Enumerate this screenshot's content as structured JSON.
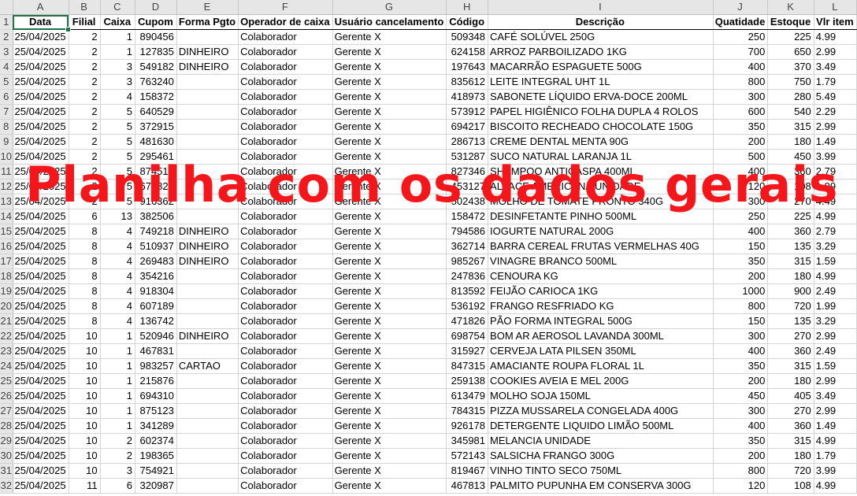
{
  "overlay_text": "Planilha com os dados gerais",
  "column_letters": [
    "A",
    "B",
    "C",
    "D",
    "E",
    "F",
    "G",
    "H",
    "I",
    "J",
    "K",
    "L"
  ],
  "headers": [
    "Data",
    "Filial",
    "Caixa",
    "Cupom",
    "Forma Pgto",
    "Operador de caixa",
    "Usuário cancelamento",
    "Código",
    "Descrição",
    "Quatidade",
    "Estoque",
    "Vlr item"
  ],
  "header_row_number": "1",
  "rows": [
    {
      "n": "2",
      "c": [
        "25/04/2025",
        "2",
        "1",
        "890456",
        "",
        "Colaborador",
        "Gerente X",
        "509348",
        "CAFÉ SOLÚVEL 250G",
        "250",
        "225",
        "4.99"
      ]
    },
    {
      "n": "3",
      "c": [
        "25/04/2025",
        "2",
        "1",
        "127835",
        "DINHEIRO",
        "Colaborador",
        "Gerente X",
        "624158",
        "ARROZ PARBOILIZADO 1KG",
        "700",
        "650",
        "2.99"
      ]
    },
    {
      "n": "4",
      "c": [
        "25/04/2025",
        "2",
        "3",
        "549182",
        "DINHEIRO",
        "Colaborador",
        "Gerente X",
        "197643",
        "MACARRÃO ESPAGUETE 500G",
        "400",
        "370",
        "3.49"
      ]
    },
    {
      "n": "5",
      "c": [
        "25/04/2025",
        "2",
        "3",
        "763240",
        "",
        "Colaborador",
        "Gerente X",
        "835612",
        "LEITE INTEGRAL UHT 1L",
        "800",
        "750",
        "1.79"
      ]
    },
    {
      "n": "6",
      "c": [
        "25/04/2025",
        "2",
        "4",
        "158372",
        "",
        "Colaborador",
        "Gerente X",
        "418973",
        "SABONETE LÍQUIDO ERVA-DOCE 200ML",
        "300",
        "280",
        "5.49"
      ]
    },
    {
      "n": "7",
      "c": [
        "25/04/2025",
        "2",
        "5",
        "640529",
        "",
        "Colaborador",
        "Gerente X",
        "573912",
        "PAPEL HIGIÊNICO FOLHA DUPLA 4 ROLOS",
        "600",
        "540",
        "2.29"
      ]
    },
    {
      "n": "8",
      "c": [
        "25/04/2025",
        "2",
        "5",
        "372915",
        "",
        "Colaborador",
        "Gerente X",
        "694217",
        "BISCOITO RECHEADO CHOCOLATE 150G",
        "350",
        "315",
        "2.99"
      ]
    },
    {
      "n": "9",
      "c": [
        "25/04/2025",
        "2",
        "5",
        "481630",
        "",
        "Colaborador",
        "Gerente X",
        "286713",
        "CREME DENTAL MENTA 90G",
        "200",
        "180",
        "1.49"
      ]
    },
    {
      "n": "10",
      "c": [
        "25/04/2025",
        "2",
        "5",
        "295461",
        "",
        "Colaborador",
        "Gerente X",
        "531287",
        "SUCO NATURAL LARANJA 1L",
        "500",
        "450",
        "3.99"
      ]
    },
    {
      "n": "11",
      "c": [
        "25/04/2025",
        "2",
        "5",
        "874510",
        "",
        "Colaborador",
        "Gerente X",
        "827346",
        "SHAMPOO ANTICASPA 400ML",
        "400",
        "360",
        "2.79"
      ]
    },
    {
      "n": "12",
      "c": [
        "25/04/2025",
        "2",
        "5",
        "673829",
        "",
        "Colaborador",
        "Gerente X",
        "453127",
        "ALFACE AMERICANA UNIDADE",
        "120",
        "108",
        "1.99"
      ]
    },
    {
      "n": "13",
      "c": [
        "25/04/2025",
        "2",
        "5",
        "916362",
        "",
        "Colaborador",
        "Gerente X",
        "502438",
        "MOLHO DE TOMATE PRONTO 340G",
        "300",
        "270",
        "4.49"
      ]
    },
    {
      "n": "14",
      "c": [
        "25/04/2025",
        "6",
        "13",
        "382506",
        "",
        "Colaborador",
        "Gerente X",
        "158472",
        "DESINFETANTE PINHO 500ML",
        "250",
        "225",
        "4.99"
      ]
    },
    {
      "n": "15",
      "c": [
        "25/04/2025",
        "8",
        "4",
        "749218",
        "DINHEIRO",
        "Colaborador",
        "Gerente X",
        "794586",
        "IOGURTE NATURAL 200G",
        "400",
        "360",
        "2.79"
      ]
    },
    {
      "n": "16",
      "c": [
        "25/04/2025",
        "8",
        "4",
        "510937",
        "DINHEIRO",
        "Colaborador",
        "Gerente X",
        "362714",
        "BARRA CEREAL FRUTAS VERMELHAS 40G",
        "150",
        "135",
        "3.29"
      ]
    },
    {
      "n": "17",
      "c": [
        "25/04/2025",
        "8",
        "4",
        "269483",
        "DINHEIRO",
        "Colaborador",
        "Gerente X",
        "985267",
        "VINAGRE BRANCO 500ML",
        "350",
        "315",
        "1.59"
      ]
    },
    {
      "n": "18",
      "c": [
        "25/04/2025",
        "8",
        "4",
        "354216",
        "",
        "Colaborador",
        "Gerente X",
        "247836",
        "CENOURA KG",
        "200",
        "180",
        "4.99"
      ]
    },
    {
      "n": "19",
      "c": [
        "25/04/2025",
        "8",
        "4",
        "918304",
        "",
        "Colaborador",
        "Gerente X",
        "813592",
        "FEIJÃO CARIOCA 1KG",
        "1000",
        "900",
        "2.49"
      ]
    },
    {
      "n": "20",
      "c": [
        "25/04/2025",
        "8",
        "4",
        "607189",
        "",
        "Colaborador",
        "Gerente X",
        "536192",
        "FRANGO RESFRIADO KG",
        "800",
        "720",
        "1.99"
      ]
    },
    {
      "n": "21",
      "c": [
        "25/04/2025",
        "8",
        "4",
        "136742",
        "",
        "Colaborador",
        "Gerente X",
        "471826",
        "PÃO FORMA INTEGRAL 500G",
        "150",
        "135",
        "3.29"
      ]
    },
    {
      "n": "22",
      "c": [
        "25/04/2025",
        "10",
        "1",
        "520946",
        "DINHEIRO",
        "Colaborador",
        "Gerente X",
        "698754",
        "BOM AR AEROSOL LAVANDA 300ML",
        "300",
        "270",
        "2.99"
      ]
    },
    {
      "n": "23",
      "c": [
        "25/04/2025",
        "10",
        "1",
        "467831",
        "",
        "Colaborador",
        "Gerente X",
        "315927",
        "CERVEJA LATA PILSEN 350ML",
        "400",
        "360",
        "2.49"
      ]
    },
    {
      "n": "24",
      "c": [
        "25/04/2025",
        "10",
        "1",
        "983257",
        "CARTAO",
        "Colaborador",
        "Gerente X",
        "847315",
        "AMACIANTE ROUPA FLORAL 1L",
        "350",
        "315",
        "1.59"
      ]
    },
    {
      "n": "25",
      "c": [
        "25/04/2025",
        "10",
        "1",
        "215876",
        "",
        "Colaborador",
        "Gerente X",
        "259138",
        "COOKIES AVEIA E MEL 200G",
        "200",
        "180",
        "2.99"
      ]
    },
    {
      "n": "26",
      "c": [
        "25/04/2025",
        "10",
        "1",
        "694310",
        "",
        "Colaborador",
        "Gerente X",
        "613479",
        "MOLHO SOJA 150ML",
        "450",
        "405",
        "3.49"
      ]
    },
    {
      "n": "27",
      "c": [
        "25/04/2025",
        "10",
        "1",
        "875123",
        "",
        "Colaborador",
        "Gerente X",
        "784315",
        "PIZZA MUSSARELA CONGELADA 400G",
        "300",
        "270",
        "2.99"
      ]
    },
    {
      "n": "28",
      "c": [
        "25/04/2025",
        "10",
        "1",
        "341289",
        "",
        "Colaborador",
        "Gerente X",
        "926178",
        "DETERGENTE LIQUIDO LIMÃO 500ML",
        "400",
        "360",
        "1.49"
      ]
    },
    {
      "n": "29",
      "c": [
        "25/04/2025",
        "10",
        "2",
        "602374",
        "",
        "Colaborador",
        "Gerente X",
        "345981",
        "MELANCIA UNIDADE",
        "350",
        "315",
        "4.99"
      ]
    },
    {
      "n": "30",
      "c": [
        "25/04/2025",
        "10",
        "2",
        "198365",
        "",
        "Colaborador",
        "Gerente X",
        "572143",
        "SALSICHA FRANGO 300G",
        "200",
        "180",
        "1.79"
      ]
    },
    {
      "n": "31",
      "c": [
        "25/04/2025",
        "10",
        "3",
        "754921",
        "",
        "Colaborador",
        "Gerente X",
        "819467",
        "VINHO TINTO SECO 750ML",
        "800",
        "720",
        "3.99"
      ]
    },
    {
      "n": "32",
      "c": [
        "25/04/2025",
        "11",
        "6",
        "320987",
        "",
        "Colaborador",
        "Gerente X",
        "467813",
        "PALMITO PUPUNHA EM CONSERVA 300G",
        "120",
        "108",
        "4.99"
      ]
    }
  ],
  "col_align": [
    "txt",
    "num",
    "num",
    "num",
    "txt",
    "txt",
    "txt",
    "num",
    "txt",
    "num",
    "num",
    "txt"
  ]
}
